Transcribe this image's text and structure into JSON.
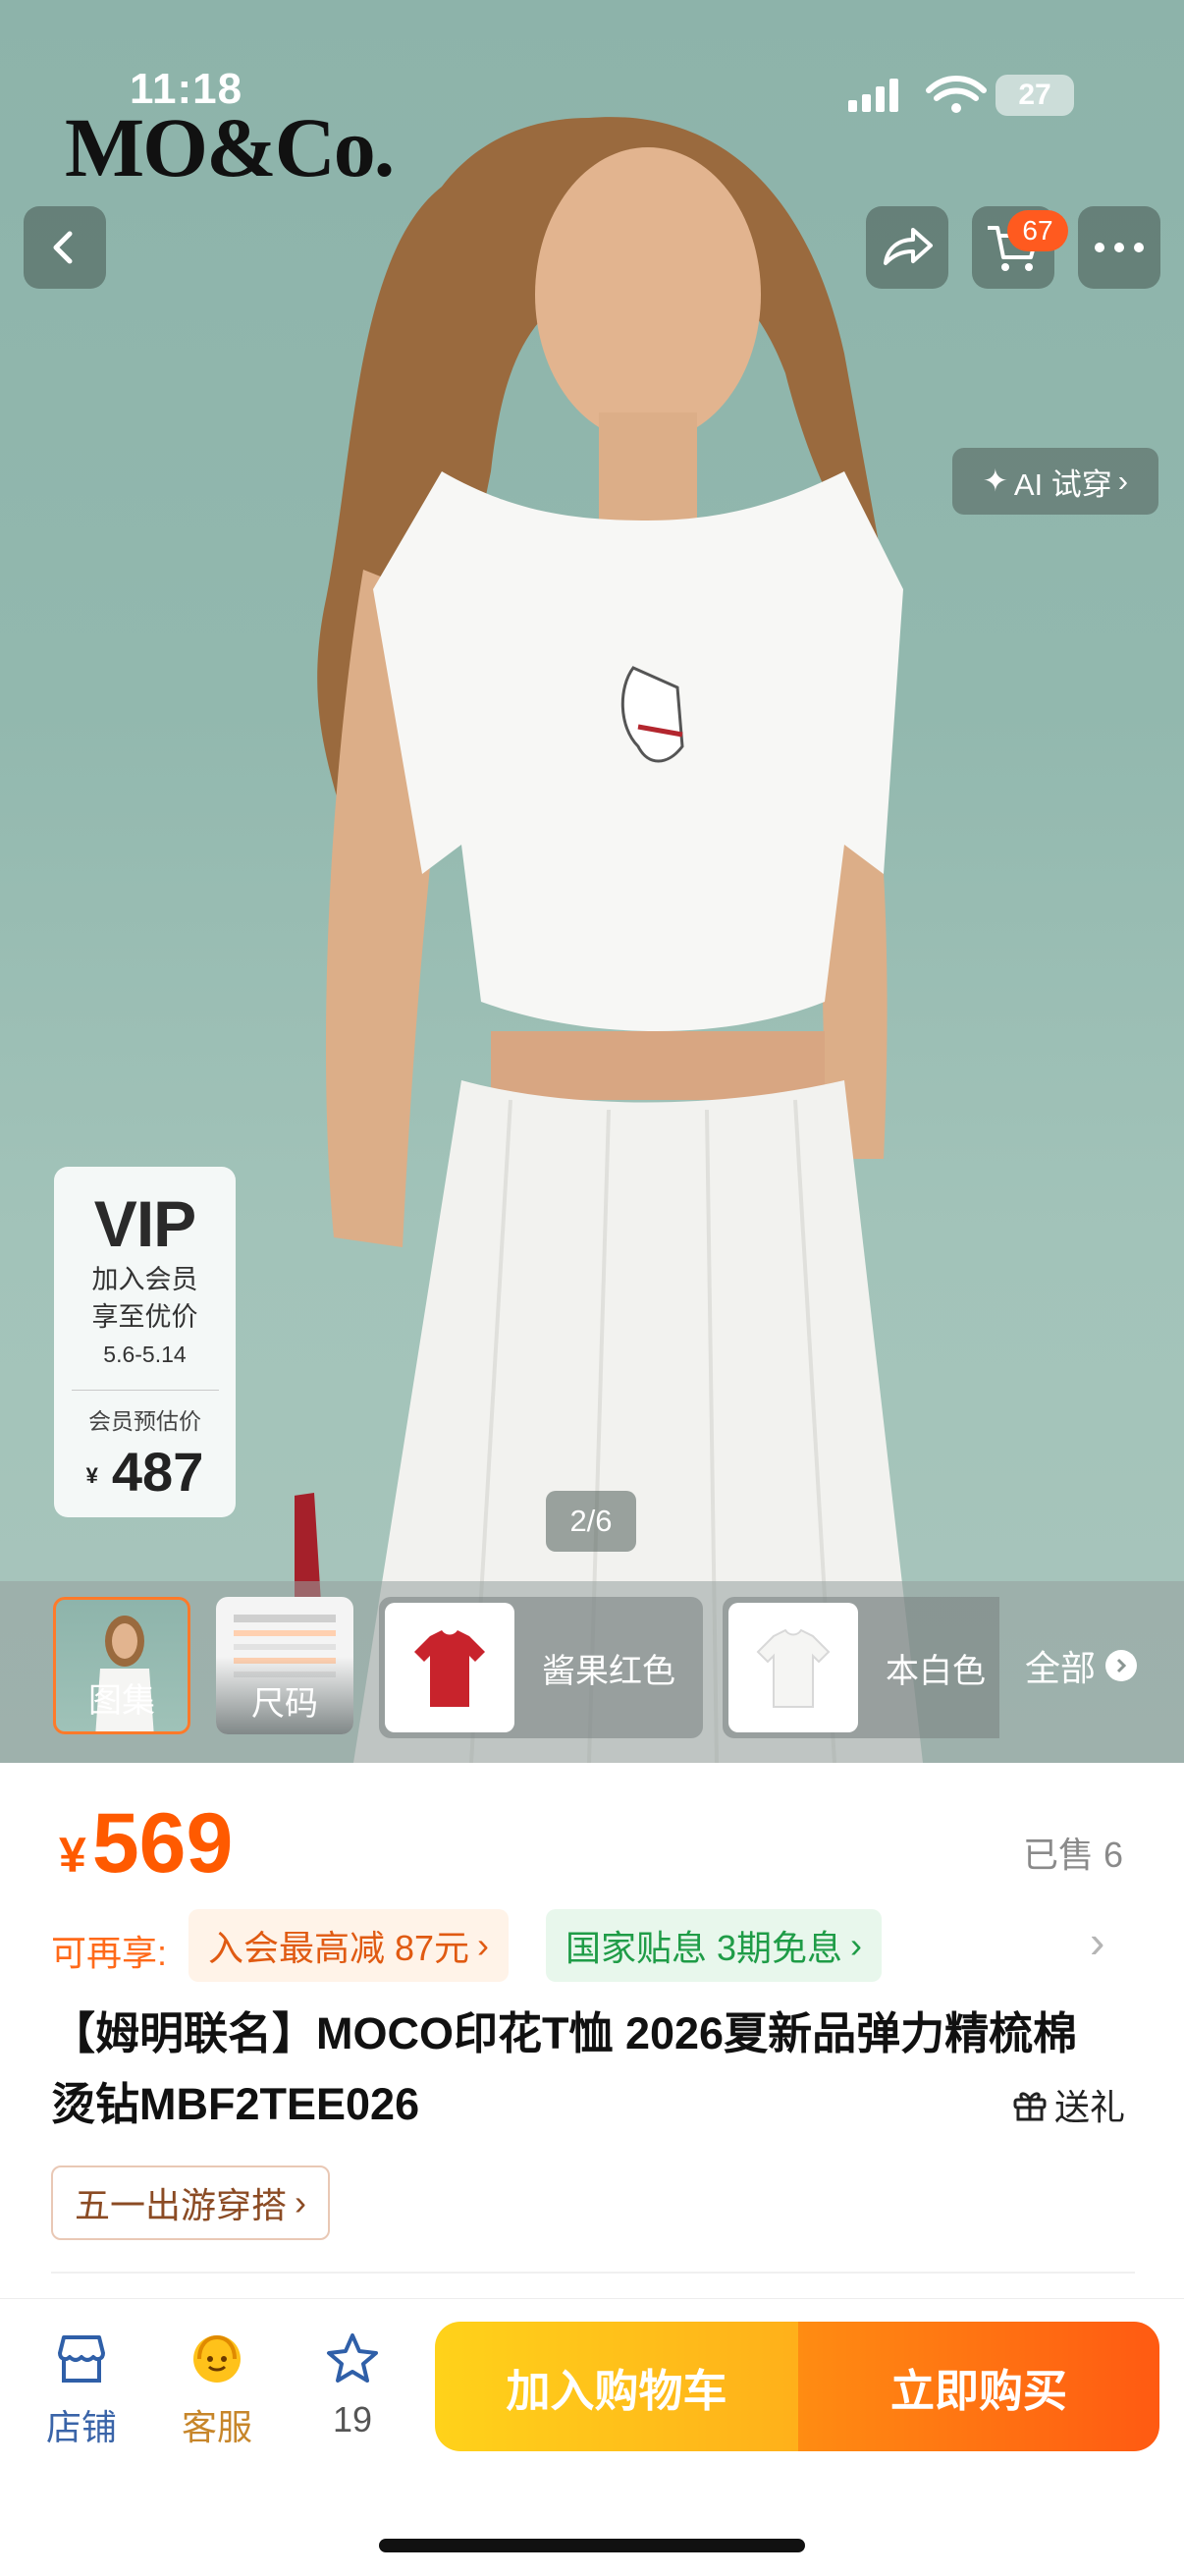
{
  "status_bar": {
    "time": "11:18",
    "battery": "27"
  },
  "brand": {
    "logo_text": "MO&Co."
  },
  "top_bar": {
    "cart_badge": "67"
  },
  "gallery": {
    "ai_tryon_label": "AI 试穿",
    "vip_card": {
      "title": "VIP",
      "line1": "加入会员",
      "line2": "享至优价",
      "dates": "5.6-5.14",
      "price_label": "会员预估价",
      "currency": "¥",
      "price": "487"
    },
    "page_indicator": "2/6"
  },
  "thumbnails": {
    "items": [
      {
        "label": "图集"
      },
      {
        "label": "尺码"
      }
    ],
    "colors": [
      {
        "label": "酱果红色",
        "swatch": "#c8232c"
      },
      {
        "label": "本白色",
        "swatch": "#f5f5f3"
      }
    ],
    "all_label": "全部",
    "mini_brand": "MO&Co."
  },
  "product": {
    "currency": "¥",
    "price": "569",
    "sold": "已售 6",
    "promo_label": "可再享:",
    "promo_member": "入会最高减 87元",
    "promo_finance": "国家贴息 3期免息",
    "title": "【姆明联名】MOCO印花T恤 2026夏新品弹力精梳棉烫钻MBF2TEE026",
    "gift_label": "送礼",
    "tag": "五一出游穿搭"
  },
  "bottom_bar": {
    "store_label": "店铺",
    "service_label": "客服",
    "fav_count": "19",
    "add_to_cart": "加入购物车",
    "buy_now": "立即购买"
  },
  "colors": {
    "accent": "#ff5a00",
    "cart_button": "#ffc21a",
    "buy_button": "#ff6a12",
    "finance_green": "#1f9c47"
  }
}
